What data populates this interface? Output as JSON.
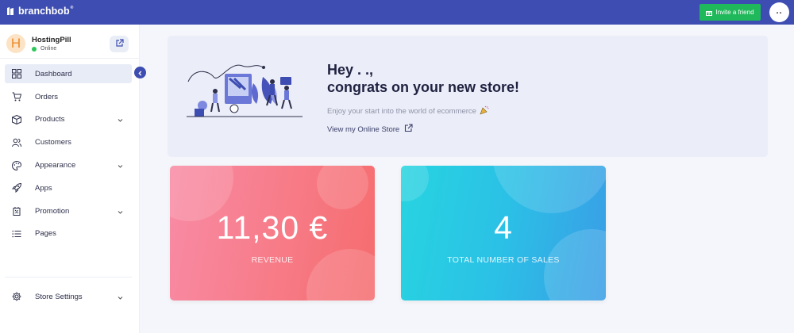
{
  "topbar": {
    "logo_text": "branchbob",
    "logo_tm": "®",
    "invite_label": "Invite a friend",
    "profile_label": "..",
    "colors": {
      "bar": "#3d4db1",
      "invite": "#1fb85a"
    }
  },
  "store": {
    "avatar_letter": "H",
    "name": "HostingPill",
    "status": "Online"
  },
  "sidebar": {
    "items": [
      {
        "label": "Dashboard",
        "icon": "grid-icon",
        "active": true,
        "has_submenu": false
      },
      {
        "label": "Orders",
        "icon": "cart-icon",
        "has_submenu": false
      },
      {
        "label": "Products",
        "icon": "box-icon",
        "has_submenu": true
      },
      {
        "label": "Customers",
        "icon": "users-icon",
        "has_submenu": false
      },
      {
        "label": "Appearance",
        "icon": "palette-icon",
        "has_submenu": true
      },
      {
        "label": "Apps",
        "icon": "rocket-icon",
        "has_submenu": false
      },
      {
        "label": "Promotion",
        "icon": "promo-icon",
        "has_submenu": true
      },
      {
        "label": "Pages",
        "icon": "list-icon",
        "has_submenu": false
      }
    ],
    "settings": {
      "label": "Store Settings",
      "icon": "gear-icon",
      "has_submenu": true
    }
  },
  "hero": {
    "title_line1": "Hey . .,",
    "title_line2": "congrats on your new store!",
    "subtitle": "Enjoy your start into the world of ecommerce",
    "link_label": "View my Online Store"
  },
  "stats": {
    "revenue": {
      "value": "11,30 €",
      "label": "REVENUE",
      "color": "#f77b87"
    },
    "sales": {
      "value": "4",
      "label": "TOTAL NUMBER OF SALES",
      "color": "#2bc0e6"
    }
  }
}
